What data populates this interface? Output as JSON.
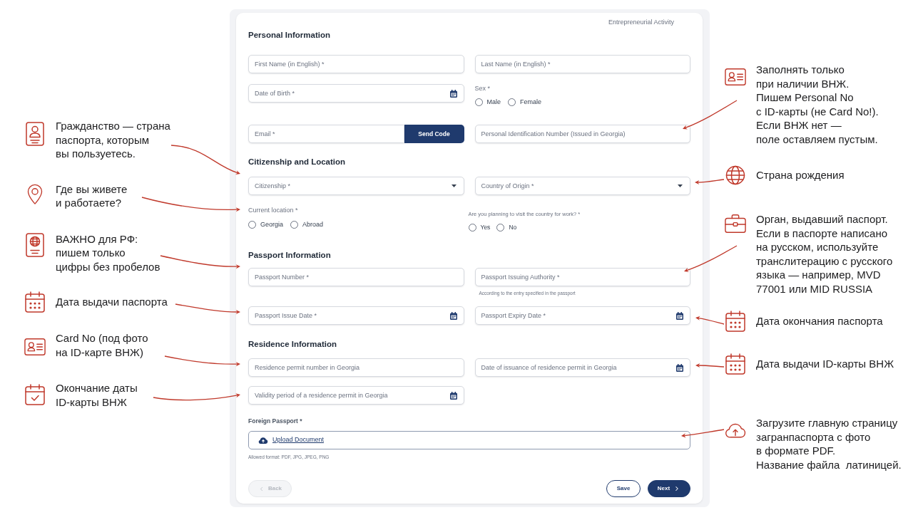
{
  "left_notes": [
    {
      "kind": "profile",
      "text": "Гражданство — страна\nпаспорта, которым\nвы пользуетесь."
    },
    {
      "kind": "pin",
      "text": "Где вы живете\nи работаете?"
    },
    {
      "kind": "passport",
      "text": "ВАЖНО для РФ:\nпишем только\nцифры без пробелов"
    },
    {
      "kind": "calendar",
      "text": "Дата выдачи паспорта"
    },
    {
      "kind": "card",
      "text": "Card No (под фото\nна ID-карте ВНЖ)"
    },
    {
      "kind": "check",
      "text": "Окончание даты\nID-карты ВНЖ"
    }
  ],
  "form": {
    "step": "Entrepreneurial Activity",
    "personal": {
      "title": "Personal Information",
      "first_name": {
        "kind": "text",
        "placeholder": "First Name (in English) *"
      },
      "last_name": {
        "kind": "text",
        "placeholder": "Last Name (in English) *"
      },
      "date_of_birth": {
        "kind": "date",
        "placeholder": "Date of Birth *"
      },
      "sex": {
        "label": "Sex *",
        "options": [
          {
            "label": "Male",
            "selected": false
          },
          {
            "label": "Female",
            "selected": false
          }
        ]
      },
      "email": {
        "kind": "text",
        "placeholder": "Email *"
      },
      "send_code": "Send Code",
      "personal_id": {
        "kind": "text",
        "placeholder": "Personal Identification Number (Issued in Georgia)"
      }
    },
    "citizenship": {
      "title": "Citizenship and Location",
      "citizenship": {
        "kind": "select",
        "placeholder": "Citizenship *"
      },
      "country_of_origin": {
        "kind": "select",
        "placeholder": "Country of Origin *"
      },
      "current_location": {
        "label": "Current location *",
        "options": [
          {
            "label": "Georgia",
            "selected": false
          },
          {
            "label": "Abroad",
            "selected": false
          }
        ]
      },
      "work_visit": {
        "label": "Are you planning to visit the country for work? *",
        "options": [
          {
            "label": "Yes",
            "selected": false
          },
          {
            "label": "No",
            "selected": false
          }
        ]
      }
    },
    "passport": {
      "title": "Passport Information",
      "number": {
        "kind": "text",
        "placeholder": "Passport Number *"
      },
      "authority": {
        "kind": "text",
        "placeholder": "Passport Issuing Authority *",
        "hint": "According to the entry specified in the passport"
      },
      "issue_date": {
        "kind": "date",
        "placeholder": "Passport Issue Date *"
      },
      "expiry_date": {
        "kind": "date",
        "placeholder": "Passport Expiry Date *"
      }
    },
    "residence": {
      "title": "Residence Information",
      "permit_number": {
        "kind": "text",
        "placeholder": "Residence permit number in Georgia"
      },
      "issuance_date": {
        "kind": "date",
        "placeholder": "Date of issuance of residence permit in Georgia"
      },
      "validity": {
        "kind": "date",
        "placeholder": "Validity period of a residence permit in Georgia"
      }
    },
    "upload": {
      "label": "Foreign Passport *",
      "link": "Upload Document",
      "hint": "Allowed format: PDF, JPG, JPEG, PNG"
    },
    "buttons": [
      {
        "kind": "prev",
        "label": "Back",
        "disabled": true
      },
      {
        "kind": "outline",
        "label": "Save",
        "disabled": false
      },
      {
        "kind": "next",
        "label": "Next",
        "disabled": false
      }
    ]
  },
  "right_notes": [
    {
      "kind": "card",
      "text": "Заполнять только\nпри наличии ВНЖ.\nПишем Personal No\nс ID-карты (не Card No!).\nЕсли ВНЖ нет —\nполе оставляем пустым."
    },
    {
      "kind": "globe",
      "text": "Страна рождения"
    },
    {
      "kind": "briefcase",
      "text": "Орган, выдавший паспорт.\nЕсли в паспорте написано\nна русском, используйте\nтранслитерацию с русского\nязыка — например, MVD\n77001 или MID RUSSIA"
    },
    {
      "kind": "calendar",
      "text": "Дата окончания паспорта"
    },
    {
      "kind": "calendar",
      "text": "Дата выдачи ID-карты ВНЖ"
    },
    {
      "kind": "upload",
      "text": "Загрузите главную страницу\nзагранпаспорта с фото\nв формате PDF.\nНазвание файла  латиницей."
    }
  ]
}
